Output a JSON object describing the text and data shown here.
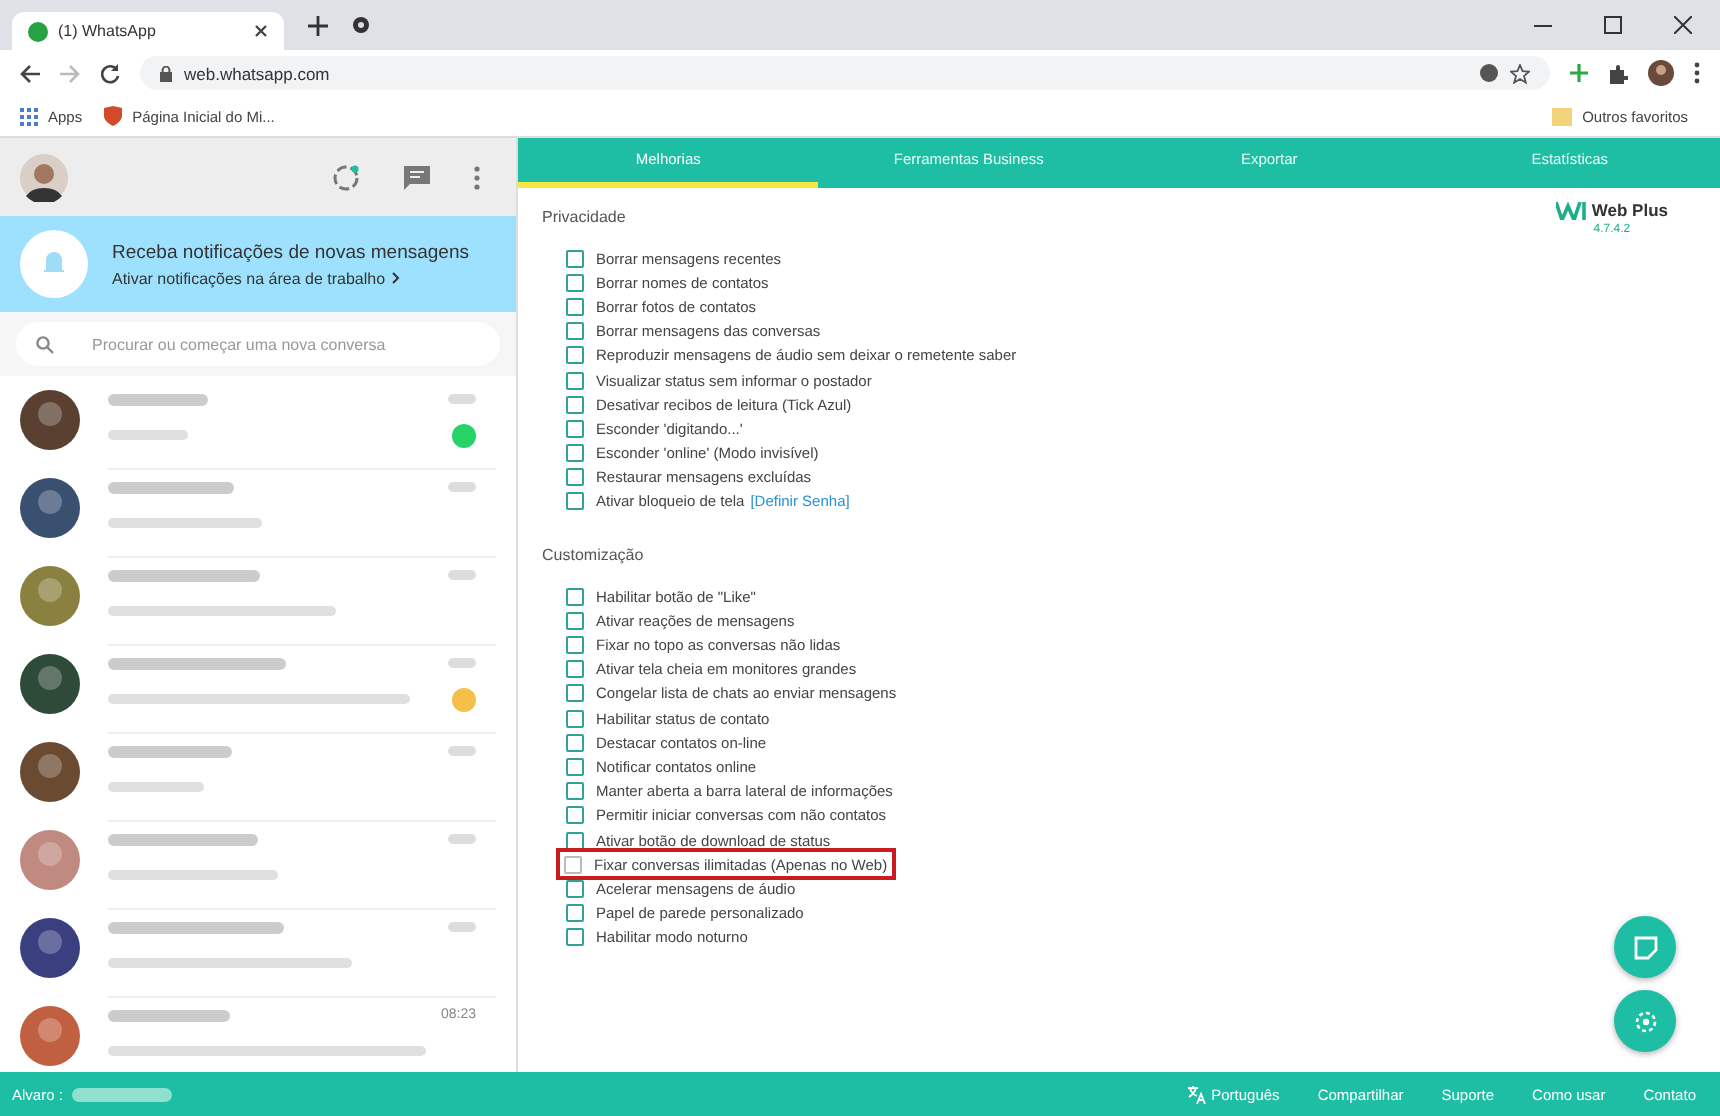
{
  "browser": {
    "tab_title": "(1) WhatsApp",
    "url": "web.whatsapp.com",
    "bookmarks": [
      "Apps",
      "Página Inicial do Mi..."
    ],
    "other_bookmarks": "Outros favoritos"
  },
  "notification": {
    "title": "Receba notificações de novas mensagens",
    "subtitle": "Ativar notificações na área de trabalho"
  },
  "search": {
    "placeholder": "Procurar ou começar uma nova conversa"
  },
  "chats": [
    {
      "unread": true,
      "color": "#25d366"
    },
    {
      "unread": false
    },
    {
      "unread": false
    },
    {
      "unread": true,
      "color": "#f5c04a"
    },
    {
      "unread": false
    },
    {
      "unread": false
    },
    {
      "unread": false
    },
    {
      "unread": false,
      "time": "08:23"
    }
  ],
  "tabs": [
    {
      "label": "Melhorias",
      "selected": true
    },
    {
      "label": "Ferramentas Business",
      "selected": false
    },
    {
      "label": "Exportar",
      "selected": false
    },
    {
      "label": "Estatísticas",
      "selected": false
    }
  ],
  "logo": {
    "name": "Web Plus",
    "version": "4.7.4.2"
  },
  "sections": [
    {
      "title": "Privacidade",
      "options": [
        {
          "label": "Borrar mensagens recentes",
          "checked": false,
          "highlighted": false
        },
        {
          "label": "Borrar nomes de contatos",
          "checked": false,
          "highlighted": false
        },
        {
          "label": "Borrar fotos de contatos",
          "checked": false,
          "highlighted": false
        },
        {
          "label": "Borrar mensagens das conversas",
          "checked": false,
          "highlighted": false
        },
        {
          "label": "Reproduzir mensagens de áudio sem deixar o remetente saber",
          "checked": false,
          "highlighted": false
        },
        {
          "label": "Visualizar status sem informar o postador",
          "checked": false,
          "highlighted": false
        },
        {
          "label": "Desativar recibos de leitura (Tick Azul)",
          "checked": false,
          "highlighted": false
        },
        {
          "label": "Esconder 'digitando...'",
          "checked": false,
          "highlighted": false
        },
        {
          "label": "Esconder 'online' (Modo invisível)",
          "checked": false,
          "highlighted": false
        },
        {
          "label": "Restaurar mensagens excluídas",
          "checked": false,
          "highlighted": false
        },
        {
          "label": "Ativar bloqueio de tela",
          "link": "[Definir Senha]",
          "checked": false,
          "highlighted": false
        }
      ]
    },
    {
      "title": "Customização",
      "options": [
        {
          "label": "Habilitar botão de \"Like\"",
          "checked": false,
          "highlighted": false
        },
        {
          "label": "Ativar reações de mensagens",
          "checked": false,
          "highlighted": false
        },
        {
          "label": "Fixar no topo as conversas não lidas",
          "checked": false,
          "highlighted": false
        },
        {
          "label": "Ativar tela cheia em monitores grandes",
          "checked": false,
          "highlighted": false
        },
        {
          "label": "Congelar lista de chats ao enviar mensagens",
          "checked": false,
          "highlighted": false
        },
        {
          "label": "Habilitar status de contato",
          "checked": false,
          "highlighted": false
        },
        {
          "label": "Destacar contatos on-line",
          "checked": false,
          "highlighted": false
        },
        {
          "label": "Notificar contatos online",
          "checked": false,
          "highlighted": false
        },
        {
          "label": "Manter aberta a barra lateral de informações",
          "checked": false,
          "highlighted": false
        },
        {
          "label": "Permitir iniciar conversas com não contatos",
          "checked": false,
          "highlighted": false
        },
        {
          "label": "Ativar botão de download de status",
          "checked": false,
          "highlighted": false
        },
        {
          "label": "Fixar conversas ilimitadas (Apenas no Web)",
          "checked": false,
          "highlighted": true
        },
        {
          "label": "Acelerar mensagens de áudio",
          "checked": false,
          "highlighted": false
        },
        {
          "label": "Papel de parede personalizado",
          "checked": false,
          "highlighted": false
        },
        {
          "label": "Habilitar modo noturno",
          "checked": false,
          "highlighted": false
        }
      ]
    }
  ],
  "footer": {
    "user": "Alvaro :",
    "language": "Português",
    "links": [
      "Compartilhar",
      "Suporte",
      "Como usar",
      "Contato"
    ]
  }
}
